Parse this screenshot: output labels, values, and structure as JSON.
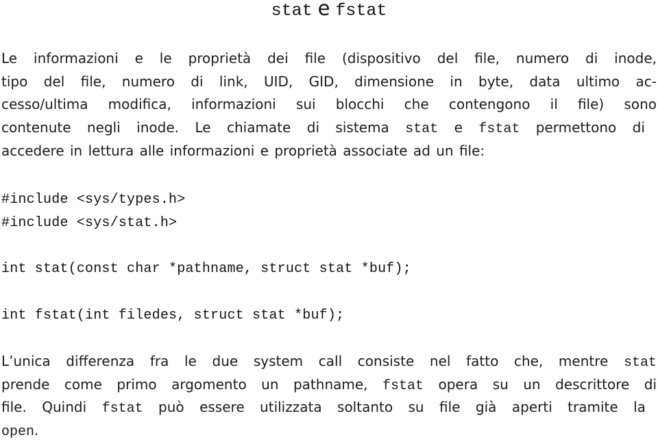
{
  "title": {
    "part1": "stat",
    "conjunction": "e",
    "part2": "fstat"
  },
  "intro_paragraph": {
    "lines": [
      {
        "text": "Le informazioni e le proprietà dei file (dispositivo del file, numero di inode,"
      },
      {
        "text": "tipo del file, numero di link, UID, GID, dimensione in byte, data ultimo ac-"
      },
      {
        "text": "cesso/ultima modifica, informazioni sui blocchi che contengono il file) sono"
      },
      {
        "pre": "contenute negli inode.  Le chiamate di sistema ",
        "code1": "stat",
        "mid": " e ",
        "code2": "fstat",
        "post": " permettono di"
      },
      {
        "text": "accedere in lettura alle informazioni e proprietà associate ad un file:"
      }
    ]
  },
  "code": {
    "includes": [
      "#include <sys/types.h>",
      "#include <sys/stat.h>"
    ],
    "signatures": [
      "int stat(const char *pathname, struct stat *buf);",
      "int fstat(int filedes, struct stat *buf);"
    ]
  },
  "closing_paragraph": {
    "lines": [
      {
        "pre": "L’unica differenza fra le due system call consiste nel fatto che, mentre ",
        "code": "stat",
        "post": ""
      },
      {
        "pre": "prende come primo argomento un pathname, ",
        "code": "fstat",
        "post": " opera su un descrittore di"
      },
      {
        "pre": "file.  Quindi ",
        "code": "fstat",
        "post": " può essere utilizzata soltanto su file già aperti tramite la"
      },
      {
        "pre": "",
        "code": "open",
        "post": "."
      }
    ]
  }
}
